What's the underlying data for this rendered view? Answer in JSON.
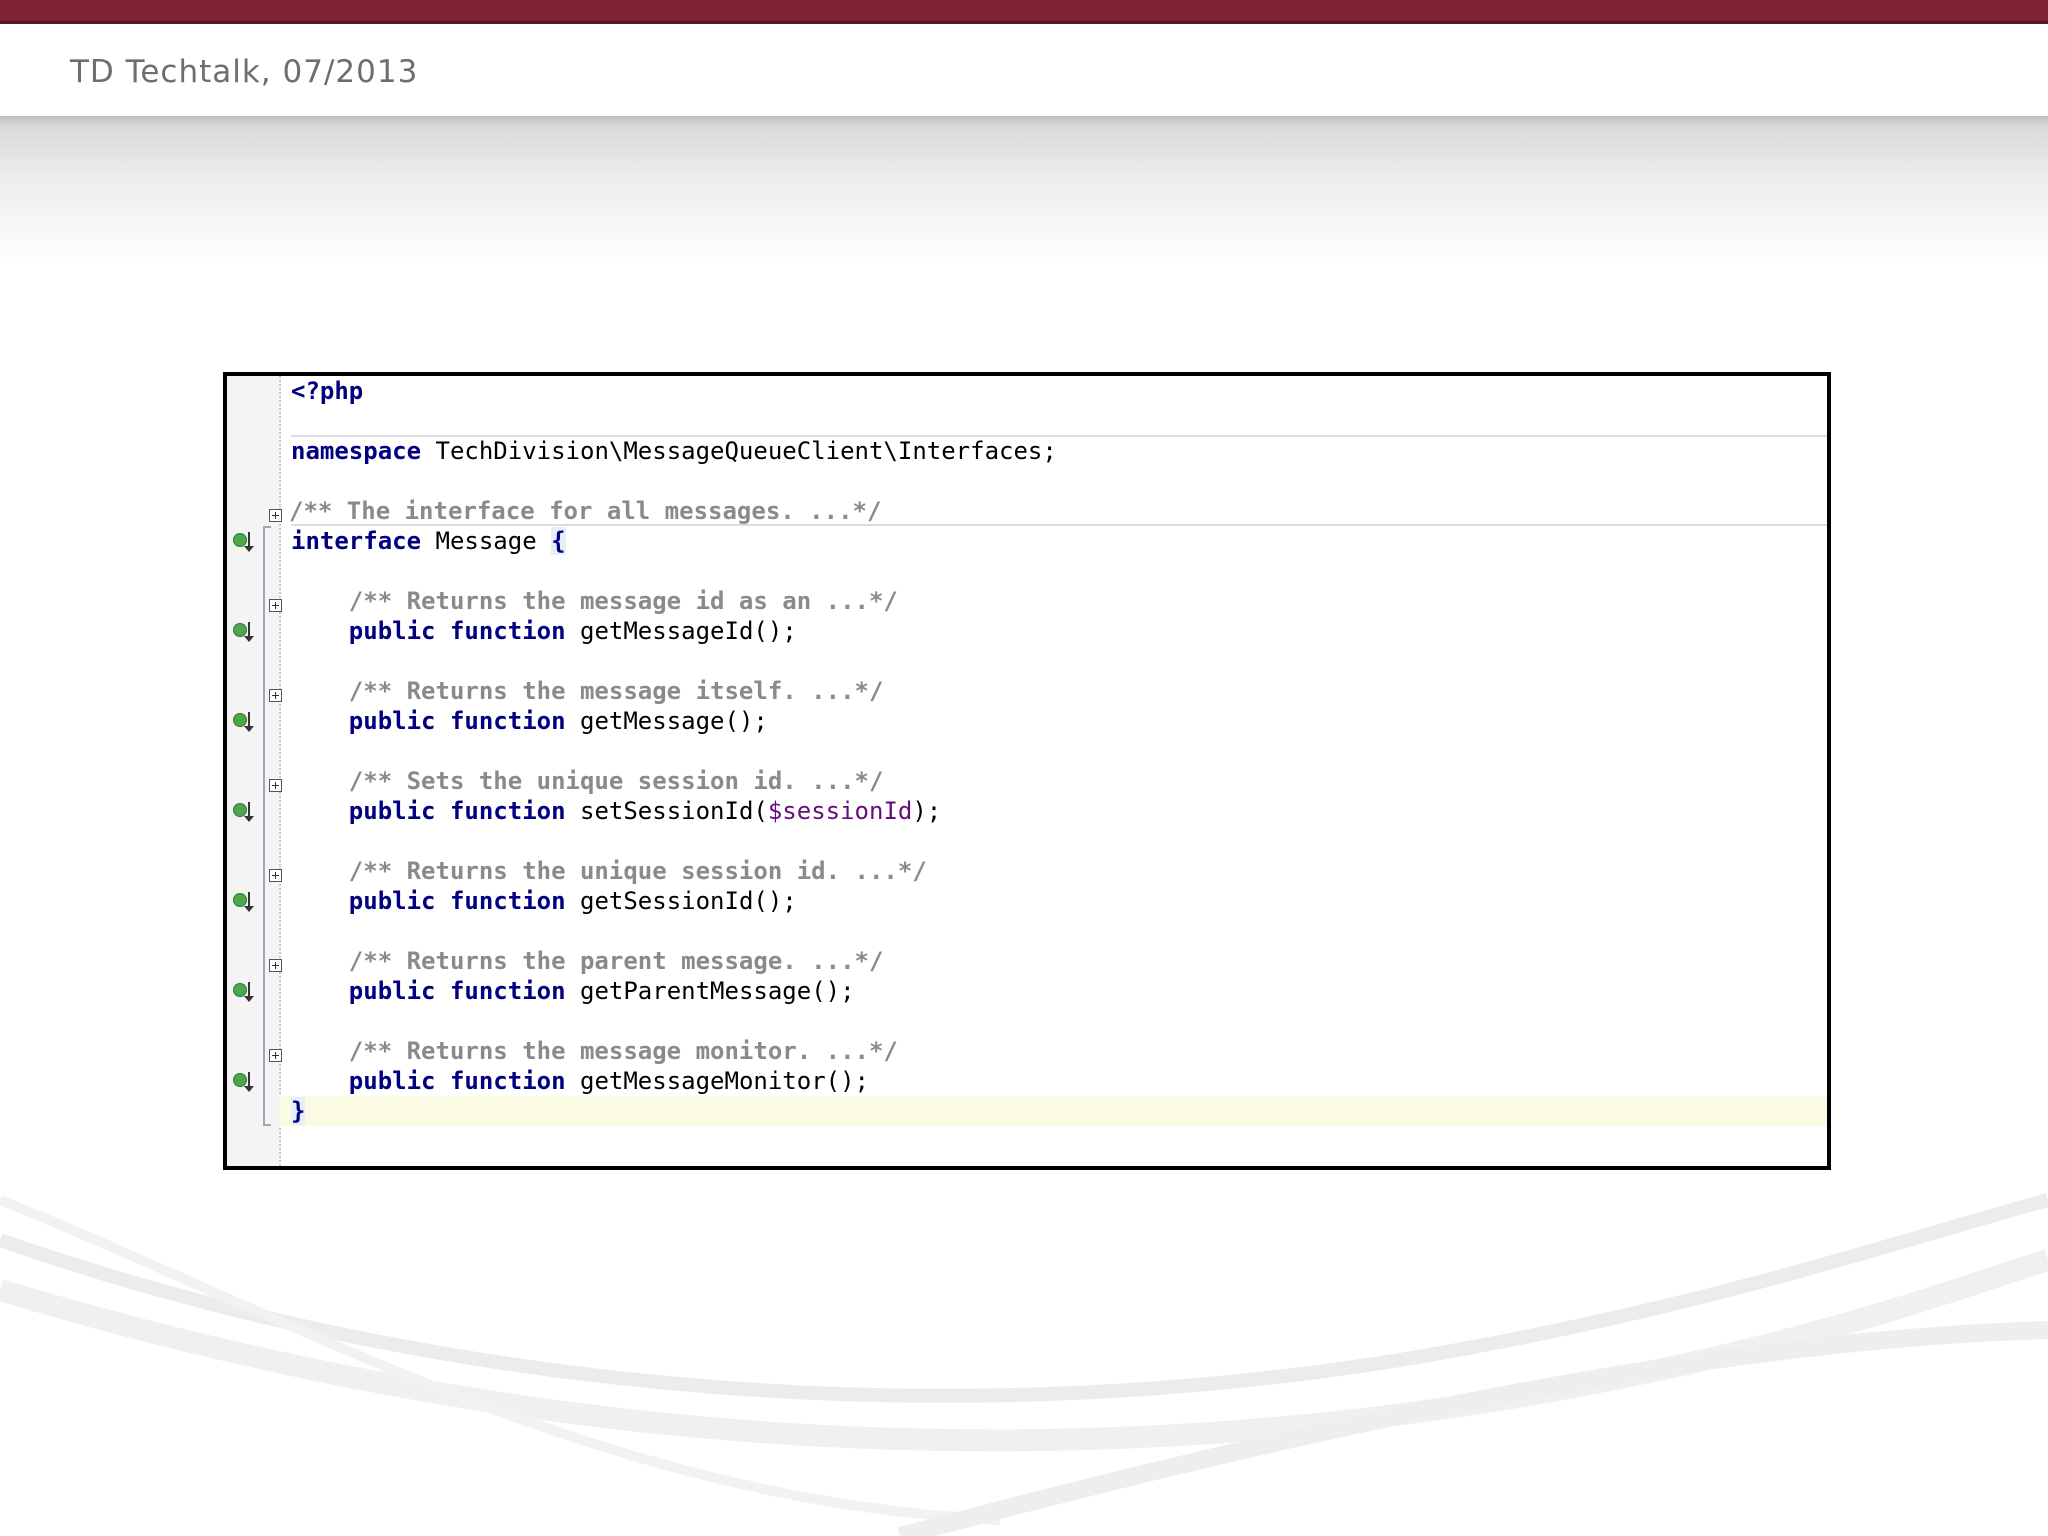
{
  "header": {
    "title": "TD Techtalk, 07/2013"
  },
  "editor": {
    "open_tag": "<?php",
    "namespace": {
      "keyword": "namespace",
      "name": "TechDivision\\MessageQueueClient\\Interfaces;"
    },
    "interface_doc": "/** The interface for all messages. ...*/",
    "interface_decl": {
      "keyword": "interface",
      "name": "Message",
      "brace_open": "{",
      "brace_close": "}"
    },
    "methods": [
      {
        "doc": "/** Returns the message id as an ...*/",
        "modifier": "public",
        "keyword": "function",
        "signature": "getMessageId();"
      },
      {
        "doc": "/** Returns the message itself. ...*/",
        "modifier": "public",
        "keyword": "function",
        "signature": "getMessage();"
      },
      {
        "doc": "/** Sets the unique session id. ...*/",
        "modifier": "public",
        "keyword": "function",
        "signature_pre": "setSessionId(",
        "param": "$sessionId",
        "signature_post": ");"
      },
      {
        "doc": "/** Returns the unique session id. ...*/",
        "modifier": "public",
        "keyword": "function",
        "signature": "getSessionId();"
      },
      {
        "doc": "/** Returns the parent message. ...*/",
        "modifier": "public",
        "keyword": "function",
        "signature": "getParentMessage();"
      },
      {
        "doc": "/** Returns the message monitor. ...*/",
        "modifier": "public",
        "keyword": "function",
        "signature": "getMessageMonitor();"
      }
    ]
  },
  "colors": {
    "top_bar": "#7d2332",
    "keyword": "#000080",
    "comment": "#8a8a8a",
    "variable": "#660e7a"
  }
}
